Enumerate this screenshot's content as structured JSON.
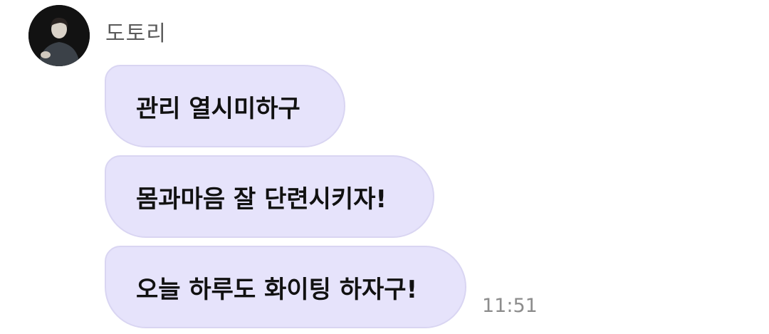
{
  "chat": {
    "sender": {
      "name": "도토리",
      "avatar_icon": "profile-photo"
    },
    "messages": [
      {
        "text": "관리 열시미하구"
      },
      {
        "text": "몸과마음 잘 단련시키자!"
      },
      {
        "text": "오늘 하루도 화이팅 하자구!"
      }
    ],
    "timestamp": "11:51"
  },
  "colors": {
    "bubble_background": "#e6e3fb",
    "bubble_border": "#d9d5f2",
    "name_text": "#5a5a5a",
    "timestamp_text": "#8c8c8c"
  }
}
